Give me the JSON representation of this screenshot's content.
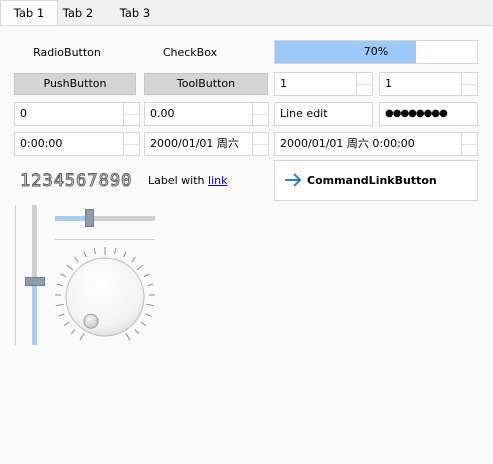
{
  "tabs": [
    {
      "label": "Tab 1",
      "active": true
    },
    {
      "label": "Tab 2",
      "active": false
    },
    {
      "label": "Tab 3",
      "active": false
    }
  ],
  "row1": {
    "radio_label": "RadioButton",
    "checkbox_label": "CheckBox",
    "progress_value": 0.7,
    "progress_text": "70%"
  },
  "row2": {
    "push_label": "PushButton",
    "tool_label": "ToolButton",
    "combo1_value": "1",
    "combo2_value": "1"
  },
  "row3": {
    "spin_int": "0",
    "spin_double": "0.00",
    "line_edit": "Line edit",
    "password": "●●●●●●●●"
  },
  "row4": {
    "time": "0:00:00",
    "date": "2000/01/01 周六",
    "datetime": "2000/01/01 周六 0:00:00"
  },
  "row5": {
    "lcd": "1234567890",
    "label_text": "Label with",
    "link_text": "link",
    "command_link": "CommandLinkButton"
  },
  "sliders": {
    "vertical_value": 0.45,
    "horizontal_value": 0.33,
    "dial_value": 0.0
  },
  "colors": {
    "accent": "#4a90d9",
    "progress_fill": "#9cc9f7",
    "slider_fill": "#aacdf4",
    "handle": "#8c9cab"
  }
}
